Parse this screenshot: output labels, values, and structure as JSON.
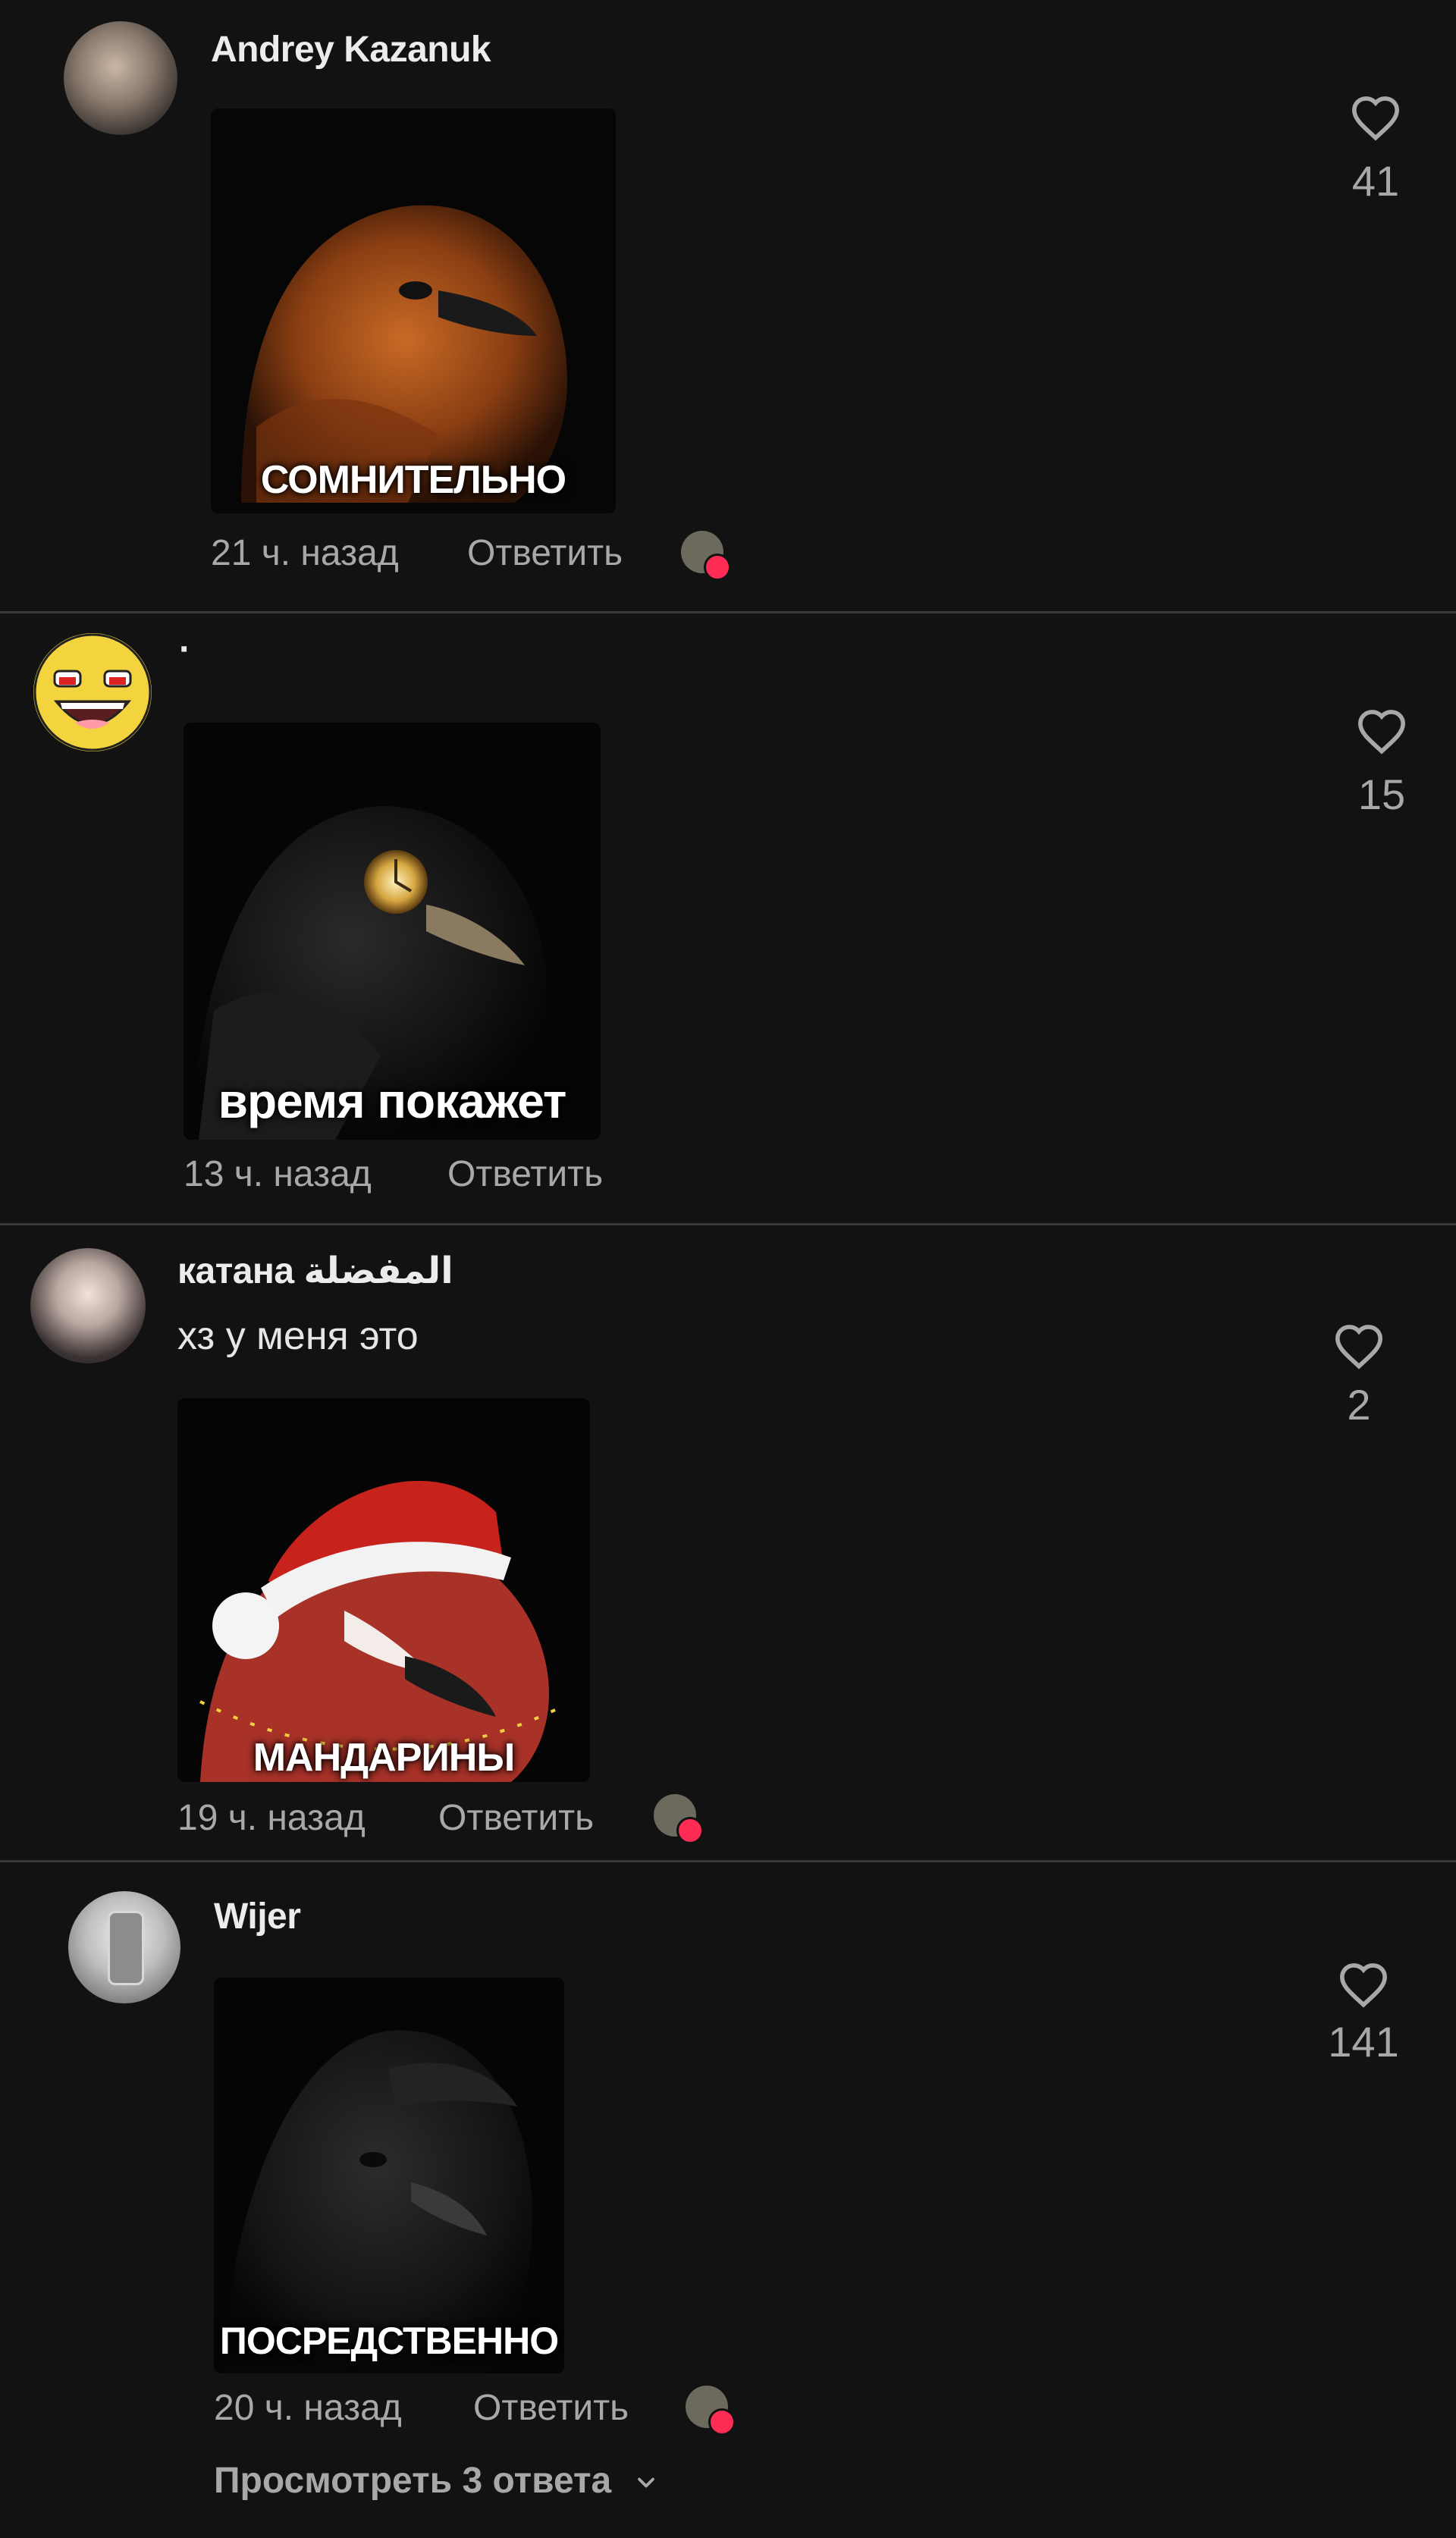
{
  "comments": [
    {
      "username": "Andrey Kazanuk",
      "time": "21 ч. назад",
      "reply_label": "Ответить",
      "likes": "41",
      "sticker_caption": "СОМНИТЕЛЬНО"
    },
    {
      "username": "·",
      "time": "13 ч. назад",
      "reply_label": "Ответить",
      "likes": "15",
      "sticker_caption": "время покажет"
    },
    {
      "username": "катана المفضلة",
      "text": "хз у меня это",
      "time": "19 ч. назад",
      "reply_label": "Ответить",
      "likes": "2",
      "sticker_caption": "МАНДАРИНЫ"
    },
    {
      "username": "Wijer",
      "time": "20 ч. назад",
      "reply_label": "Ответить",
      "likes": "141",
      "sticker_caption": "ПОСРЕДСТВЕННО",
      "view_replies": "Просмотреть 3 ответа"
    }
  ],
  "colors": {
    "background": "#121212",
    "separator": "#3a3a3a",
    "muted_text": "#a8a8a8",
    "like_badge": "#fe2c55"
  },
  "icons": [
    "heart-outline-icon",
    "chevron-down-icon",
    "liked-by-creator-icon"
  ]
}
